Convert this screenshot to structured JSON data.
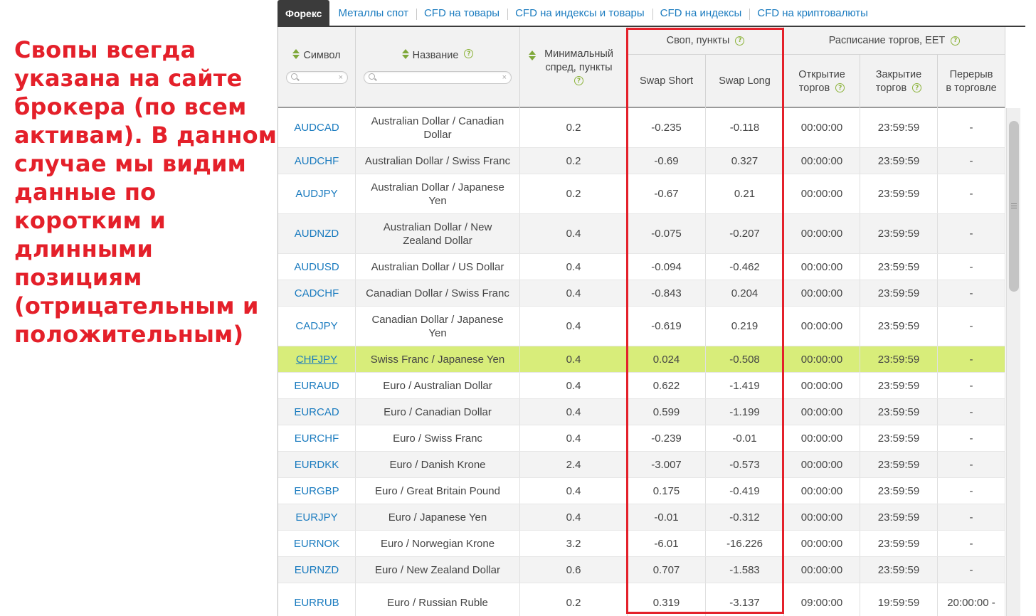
{
  "annotation": {
    "lines": [
      "Свопы всегда",
      "указана на сайте",
      "брокера (по всем",
      "активам). В данном",
      "случае мы видим",
      "данные по",
      "коротким и",
      "длинными",
      "позициям",
      "(отрицательным и",
      "положительным)"
    ],
    "color": "#e4202a"
  },
  "tabs": {
    "active": "Форекс",
    "items": [
      "Металлы спот",
      "CFD на товары",
      "CFD на индексы и товары",
      "CFD на индексы",
      "CFD на криптовалюты"
    ]
  },
  "header": {
    "symbol": "Символ",
    "name": "Название",
    "min_spread": "Минимальный спред, пункты",
    "swap_group": "Своп, пункты",
    "swap_short": "Swap Short",
    "swap_long": "Swap Long",
    "schedule_group": "Расписание торгов, EET",
    "open": "Открытие торгов",
    "close": "Закрытие торгов",
    "break": "Перерыв в торговле",
    "help_glyph": "?"
  },
  "rows": [
    {
      "symbol": "AUDCAD",
      "name": "Australian Dollar / Canadian Dollar",
      "spread": "0.2",
      "swap_short": "-0.235",
      "swap_long": "-0.118",
      "open": "00:00:00",
      "close": "23:59:59",
      "break": "-"
    },
    {
      "symbol": "AUDCHF",
      "name": "Australian Dollar / Swiss Franc",
      "spread": "0.2",
      "swap_short": "-0.69",
      "swap_long": "0.327",
      "open": "00:00:00",
      "close": "23:59:59",
      "break": "-"
    },
    {
      "symbol": "AUDJPY",
      "name": "Australian Dollar / Japanese Yen",
      "spread": "0.2",
      "swap_short": "-0.67",
      "swap_long": "0.21",
      "open": "00:00:00",
      "close": "23:59:59",
      "break": "-"
    },
    {
      "symbol": "AUDNZD",
      "name": "Australian Dollar / New Zealand Dollar",
      "spread": "0.4",
      "swap_short": "-0.075",
      "swap_long": "-0.207",
      "open": "00:00:00",
      "close": "23:59:59",
      "break": "-"
    },
    {
      "symbol": "AUDUSD",
      "name": "Australian Dollar / US Dollar",
      "spread": "0.4",
      "swap_short": "-0.094",
      "swap_long": "-0.462",
      "open": "00:00:00",
      "close": "23:59:59",
      "break": "-"
    },
    {
      "symbol": "CADCHF",
      "name": "Canadian Dollar / Swiss Franc",
      "spread": "0.4",
      "swap_short": "-0.843",
      "swap_long": "0.204",
      "open": "00:00:00",
      "close": "23:59:59",
      "break": "-"
    },
    {
      "symbol": "CADJPY",
      "name": "Canadian Dollar / Japanese Yen",
      "spread": "0.4",
      "swap_short": "-0.619",
      "swap_long": "0.219",
      "open": "00:00:00",
      "close": "23:59:59",
      "break": "-"
    },
    {
      "symbol": "CHFJPY",
      "name": "Swiss Franc / Japanese Yen",
      "spread": "0.4",
      "swap_short": "0.024",
      "swap_long": "-0.508",
      "open": "00:00:00",
      "close": "23:59:59",
      "break": "-"
    },
    {
      "symbol": "EURAUD",
      "name": "Euro / Australian Dollar",
      "spread": "0.4",
      "swap_short": "0.622",
      "swap_long": "-1.419",
      "open": "00:00:00",
      "close": "23:59:59",
      "break": "-"
    },
    {
      "symbol": "EURCAD",
      "name": "Euro / Canadian Dollar",
      "spread": "0.4",
      "swap_short": "0.599",
      "swap_long": "-1.199",
      "open": "00:00:00",
      "close": "23:59:59",
      "break": "-"
    },
    {
      "symbol": "EURCHF",
      "name": "Euro / Swiss Franc",
      "spread": "0.4",
      "swap_short": "-0.239",
      "swap_long": "-0.01",
      "open": "00:00:00",
      "close": "23:59:59",
      "break": "-"
    },
    {
      "symbol": "EURDKK",
      "name": "Euro / Danish Krone",
      "spread": "2.4",
      "swap_short": "-3.007",
      "swap_long": "-0.573",
      "open": "00:00:00",
      "close": "23:59:59",
      "break": "-"
    },
    {
      "symbol": "EURGBP",
      "name": "Euro / Great Britain Pound",
      "spread": "0.4",
      "swap_short": "0.175",
      "swap_long": "-0.419",
      "open": "00:00:00",
      "close": "23:59:59",
      "break": "-"
    },
    {
      "symbol": "EURJPY",
      "name": "Euro / Japanese Yen",
      "spread": "0.4",
      "swap_short": "-0.01",
      "swap_long": "-0.312",
      "open": "00:00:00",
      "close": "23:59:59",
      "break": "-"
    },
    {
      "symbol": "EURNOK",
      "name": "Euro / Norwegian Krone",
      "spread": "3.2",
      "swap_short": "-6.01",
      "swap_long": "-16.226",
      "open": "00:00:00",
      "close": "23:59:59",
      "break": "-"
    },
    {
      "symbol": "EURNZD",
      "name": "Euro / New Zealand Dollar",
      "spread": "0.6",
      "swap_short": "0.707",
      "swap_long": "-1.583",
      "open": "00:00:00",
      "close": "23:59:59",
      "break": "-"
    },
    {
      "symbol": "EURRUB",
      "name": "Euro / Russian Ruble",
      "spread": "0.2",
      "swap_short": "0.319",
      "swap_long": "-3.137",
      "open": "09:00:00",
      "close": "19:59:59",
      "break": "20:00:00 -"
    }
  ],
  "highlighted_symbol": "CHFJPY",
  "colors": {
    "link": "#1a7bbf",
    "highlight_row": "#d8ed7a",
    "frame": "#e4202a",
    "help_icon": "#8cb33a"
  }
}
